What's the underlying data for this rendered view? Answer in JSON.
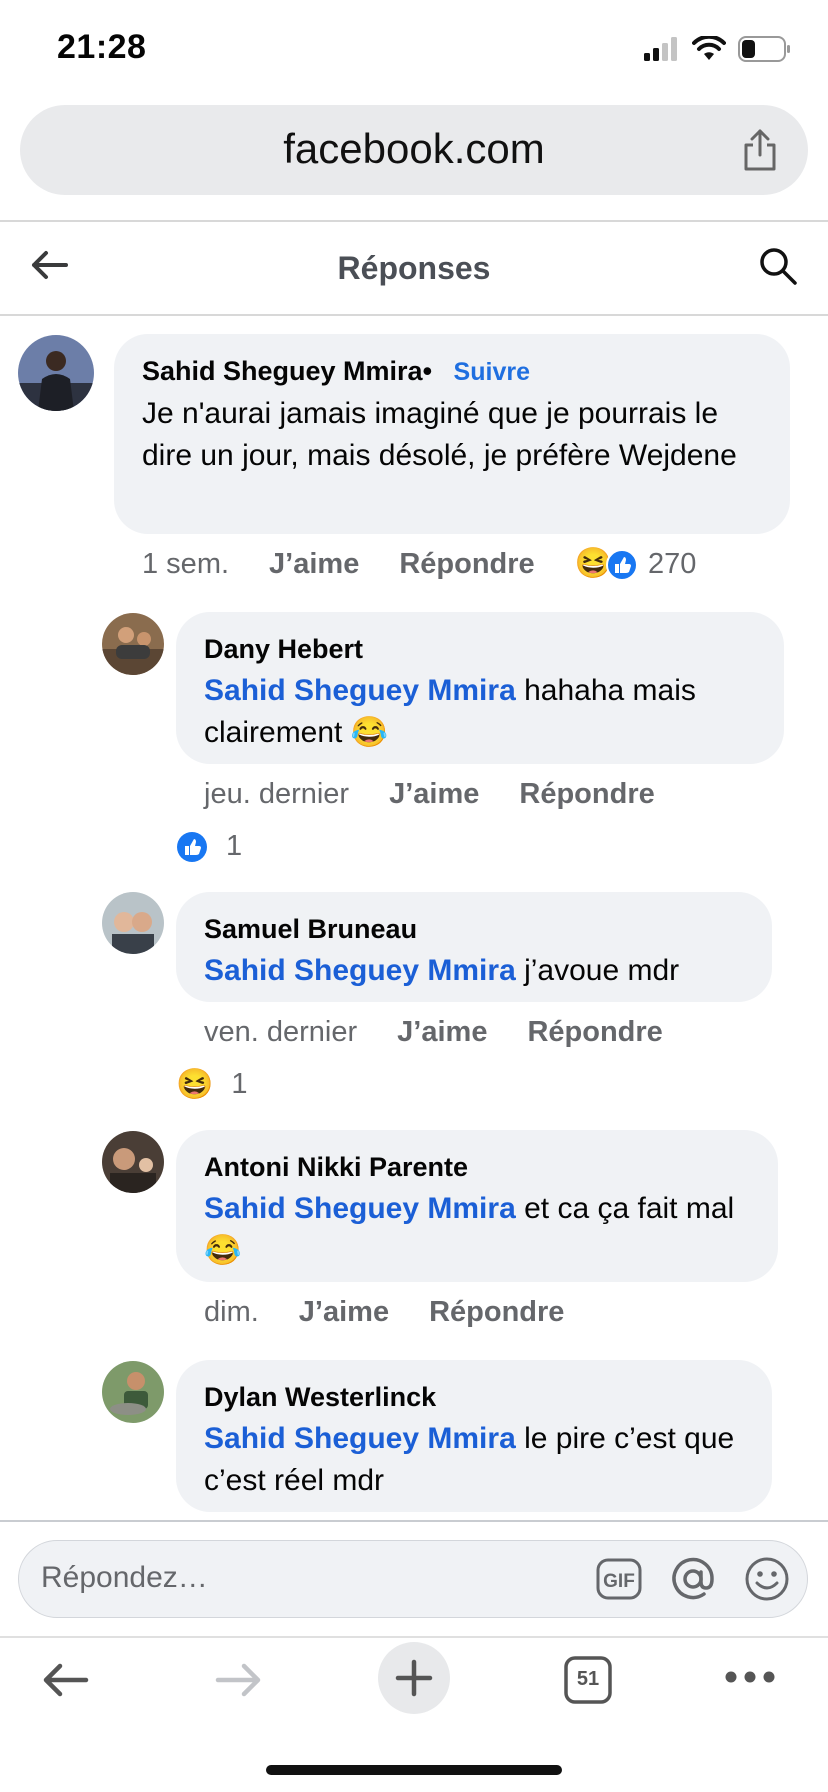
{
  "status_bar": {
    "time": "21:28"
  },
  "browser": {
    "url": "facebook.com",
    "tab_count": "51"
  },
  "header": {
    "title": "Réponses"
  },
  "comments": [
    {
      "author": "Sahid Sheguey Mmira",
      "author_suffix": "•",
      "follow_label": "Suivre",
      "text": "Je n'aurai jamais imaginé que je pourrais le dire un jour, mais désolé, je préfère Wejdene",
      "time": "1 sem.",
      "like_label": "J’aime",
      "reply_label": "Répondre",
      "reaction_count": "270",
      "reactions": [
        "haha",
        "like"
      ]
    },
    {
      "author": "Dany Hebert",
      "mention": "Sahid Sheguey Mmira",
      "text": " hahaha mais clairement 😂",
      "time": "jeu. dernier",
      "like_label": "J’aime",
      "reply_label": "Répondre",
      "reaction_count": "1",
      "reactions": [
        "like"
      ]
    },
    {
      "author": "Samuel Bruneau",
      "mention": "Sahid Sheguey Mmira",
      "text": " j’avoue mdr",
      "time": "ven. dernier",
      "like_label": "J’aime",
      "reply_label": "Répondre",
      "reaction_count": "1",
      "reactions": [
        "haha"
      ]
    },
    {
      "author": "Antoni Nikki Parente",
      "mention": "Sahid Sheguey Mmira",
      "text": " et ca ça fait mal 😂",
      "time": "dim.",
      "like_label": "J’aime",
      "reply_label": "Répondre"
    },
    {
      "author": "Dylan Westerlinck",
      "mention": "Sahid Sheguey Mmira",
      "text": " le pire c’est que c’est réel mdr"
    }
  ],
  "compose": {
    "placeholder": "Répondez…",
    "gif_label": "GIF"
  },
  "colors": {
    "mention": "#1b5fd6",
    "like_blue": "#1877f2",
    "bubble": "#f0f2f5",
    "meta_gray": "#65676b"
  }
}
